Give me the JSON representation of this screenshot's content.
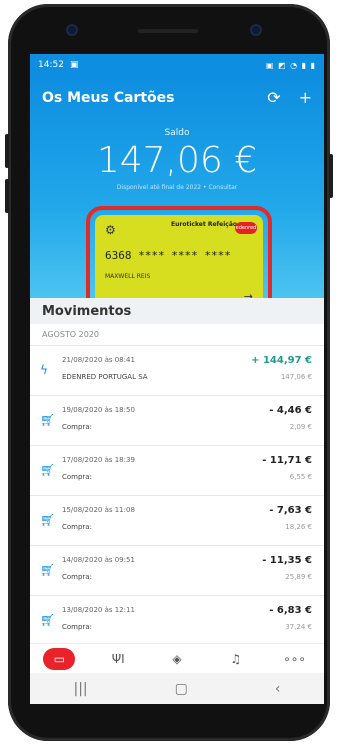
{
  "status_bar": {
    "time": "14:52",
    "right_icons": "▣ ◩ ◔ ▮ ▮"
  },
  "header": {
    "title": "Os Meus Cartões",
    "refresh_icon": "refresh-icon",
    "add_icon": "plus-icon"
  },
  "balance": {
    "label": "Saldo",
    "value": "147,06 €",
    "validity_text": "Disponível até final de 2022 • Consultar"
  },
  "card": {
    "brand": "Euroticket Refeição",
    "brand_logo": "edenred",
    "number": "6368 **** **** ****",
    "holder": "MAXWELL REIS",
    "colors": {
      "card": "#d6de1f",
      "highlight": "#e02b2b"
    }
  },
  "movements": {
    "title": "Movimentos",
    "month": "AGOSTO 2020",
    "items": [
      {
        "icon": "lightning-icon",
        "date": "21/08/2020 às 08:41",
        "desc": "EDENRED PORTUGAL SA",
        "amount": "+ 144,97 €",
        "balance": "147,06 €",
        "positive": true
      },
      {
        "icon": "cart-icon",
        "date": "19/08/2020 às 18:50",
        "desc": "Compra:",
        "amount": "- 4,46 €",
        "balance": "2,09 €",
        "positive": false
      },
      {
        "icon": "cart-icon",
        "date": "17/08/2020 às 18:39",
        "desc": "Compra:",
        "amount": "- 11,71 €",
        "balance": "6,55 €",
        "positive": false
      },
      {
        "icon": "cart-icon",
        "date": "15/08/2020 às 11:08",
        "desc": "Compra:",
        "amount": "- 7,63 €",
        "balance": "18,26 €",
        "positive": false
      },
      {
        "icon": "cart-icon",
        "date": "14/08/2020 às 09:51",
        "desc": "Compra:",
        "amount": "- 11,35 €",
        "balance": "25,89 €",
        "positive": false
      },
      {
        "icon": "cart-icon",
        "date": "13/08/2020 às 12:11",
        "desc": "Compra:",
        "amount": "- 6,83 €",
        "balance": "37,24 €",
        "positive": false
      }
    ]
  },
  "bottom_nav": {
    "items": [
      {
        "name": "cards",
        "icon": "card-icon",
        "glyph": "▭",
        "active": true
      },
      {
        "name": "restaurants",
        "icon": "fork-knife-icon",
        "glyph": "ΨΙ",
        "active": false
      },
      {
        "name": "offers",
        "icon": "tag-icon",
        "glyph": "◈",
        "active": false
      },
      {
        "name": "notifications",
        "icon": "bell-icon",
        "glyph": "♫",
        "active": false
      },
      {
        "name": "more",
        "icon": "more-icon",
        "glyph": "∘∘∘",
        "active": false
      }
    ]
  },
  "android_nav": {
    "recent": "|||",
    "home": "▢",
    "back": "‹"
  },
  "colors": {
    "primary": "#0e8ee0",
    "accent": "#e8232a",
    "positive": "#1f9d8a"
  }
}
